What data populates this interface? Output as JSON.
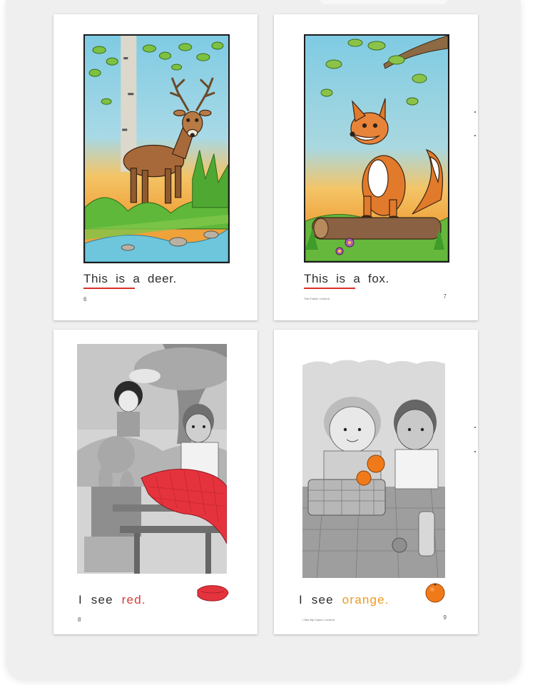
{
  "pages": [
    {
      "words": [
        "This",
        "is",
        "a",
        "deer."
      ],
      "page_number": "6",
      "footer": "",
      "illustration": "deer-in-forest"
    },
    {
      "words": [
        "This",
        "is",
        "a",
        "fox."
      ],
      "page_number": "7",
      "footer": "The Forest • Level A",
      "illustration": "fox-on-log"
    },
    {
      "words": [
        "I",
        "see",
        "red."
      ],
      "page_number": "8",
      "footer": "",
      "illustration": "children-with-red-blanket",
      "highlight_color": "#d93a3a"
    },
    {
      "words": [
        "I",
        "see",
        "orange."
      ],
      "page_number": "9",
      "footer": "I See My Colors • Level A",
      "illustration": "children-with-orange-basket",
      "highlight_color": "#ef9a1e"
    }
  ],
  "colors": {
    "underline": "#d9302a",
    "red": "#d93a3a",
    "orange": "#ef9a1e",
    "background": "#efefef"
  }
}
